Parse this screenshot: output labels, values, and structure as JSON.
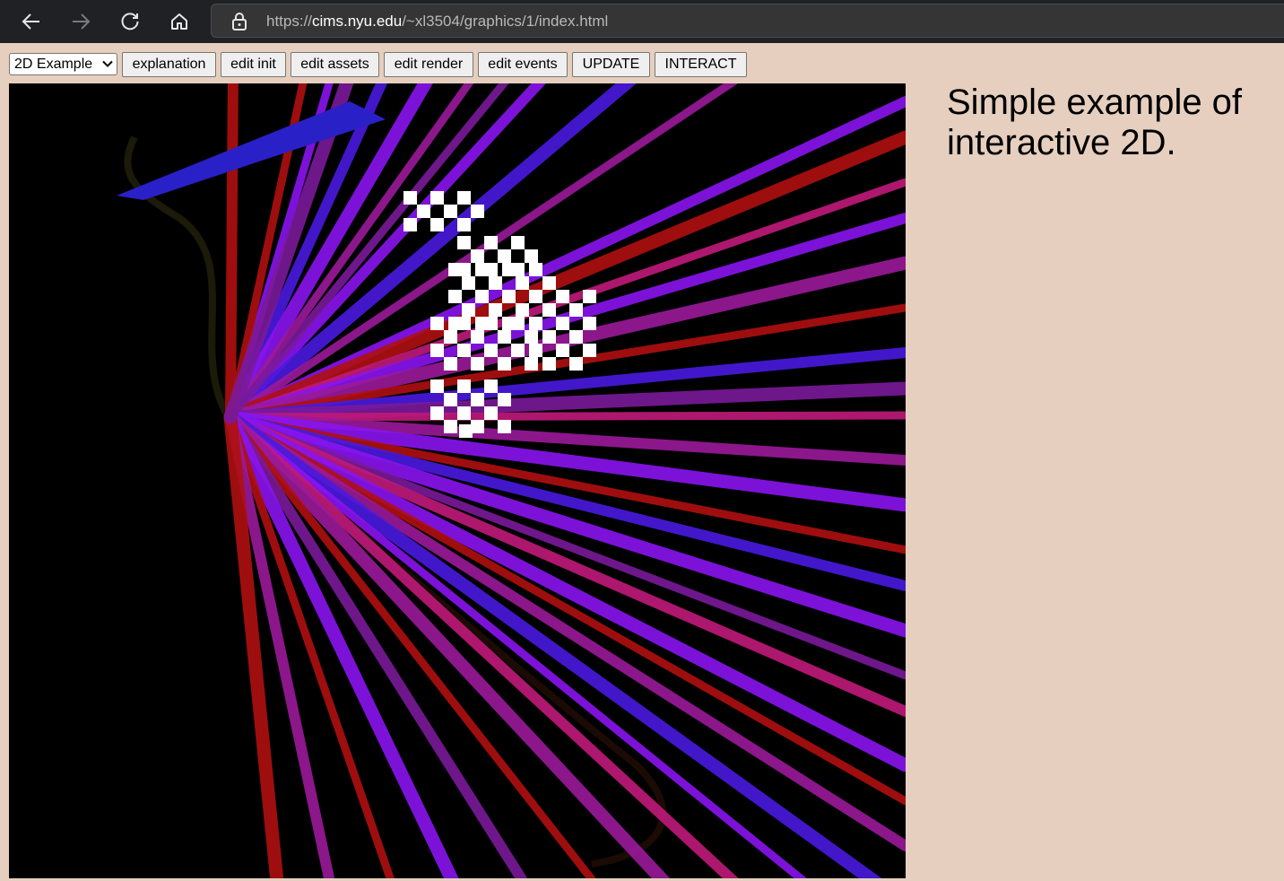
{
  "browser": {
    "url_prefix": "https://",
    "url_host": "cims.nyu.edu",
    "url_path": "/~xl3504/graphics/1/index.html",
    "icons": [
      "back-arrow-icon",
      "forward-arrow-icon",
      "reload-icon",
      "home-icon",
      "lock-icon"
    ]
  },
  "toolbar": {
    "select_value": "2D Example",
    "buttons": [
      "explanation",
      "edit init",
      "edit assets",
      "edit render",
      "edit events",
      "UPDATE",
      "INTERACT"
    ]
  },
  "description": "Simple example of interactive 2D.",
  "colors": {
    "page_bg": "#e6cfbf",
    "canvas_bg": "#000000",
    "ray_colors": [
      "#8a14f0",
      "#9b1a9b",
      "#b01010",
      "#4a1ae0",
      "#7a1a9a",
      "#c01a7a"
    ]
  }
}
